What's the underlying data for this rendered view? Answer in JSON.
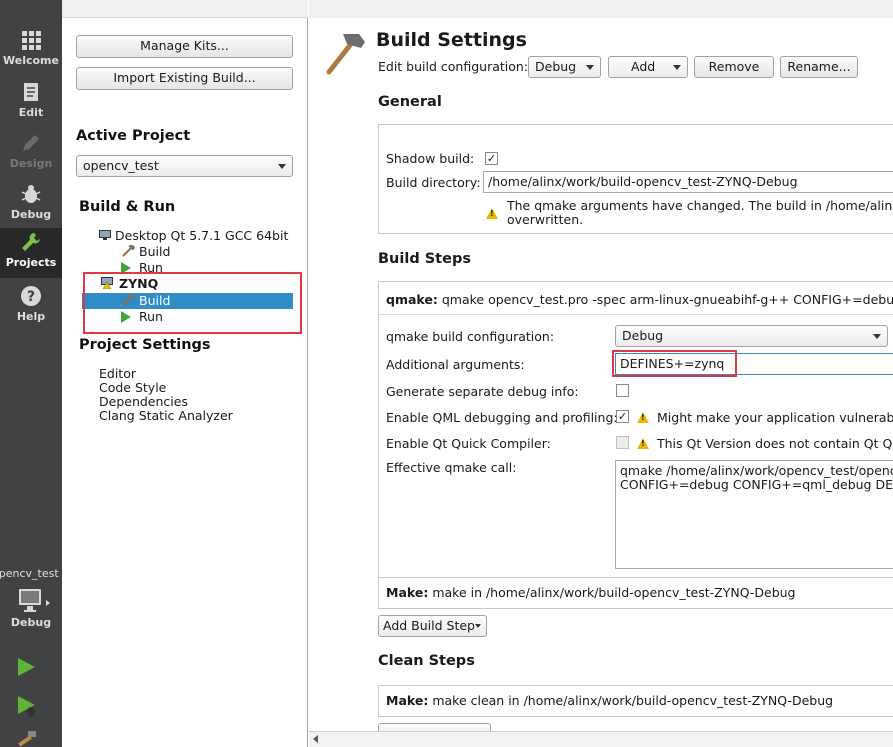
{
  "modebar": {
    "modes": [
      {
        "id": "welcome",
        "label": "Welcome",
        "icon": "grid-icon"
      },
      {
        "id": "edit",
        "label": "Edit",
        "icon": "document-icon"
      },
      {
        "id": "design",
        "label": "Design",
        "icon": "pencil-icon"
      },
      {
        "id": "debug",
        "label": "Debug",
        "icon": "bug-icon"
      },
      {
        "id": "projects",
        "label": "Projects",
        "icon": "wrench-icon"
      },
      {
        "id": "help",
        "label": "Help",
        "icon": "question-icon"
      }
    ],
    "target_project": "opencv_test",
    "target_kit_label": "Debug"
  },
  "nav": {
    "manage_kits": "Manage Kits...",
    "import_build": "Import Existing Build...",
    "active_project_title": "Active Project",
    "active_project_value": "opencv_test",
    "build_run_title": "Build & Run",
    "kits": [
      {
        "name": "Desktop Qt 5.7.1 GCC 64bit",
        "build": "Build",
        "run": "Run"
      },
      {
        "name": "ZYNQ",
        "build": "Build",
        "run": "Run"
      }
    ],
    "project_settings_title": "Project Settings",
    "project_settings": [
      "Editor",
      "Code Style",
      "Dependencies",
      "Clang Static Analyzer"
    ]
  },
  "main": {
    "title": "Build Settings",
    "edit_config_label": "Edit build configuration:",
    "config_value": "Debug",
    "add_label": "Add",
    "remove_label": "Remove",
    "rename_label": "Rename...",
    "general": {
      "title": "General",
      "shadow_build_label": "Shadow build:",
      "shadow_build_checked": "✓",
      "build_dir_label": "Build directory:",
      "build_dir_value": "/home/alinx/work/build-opencv_test-ZYNQ-Debug",
      "warning_line1": "The qmake arguments have changed. The build in /home/alinx/w",
      "warning_line2": "overwritten."
    },
    "build_steps": {
      "title": "Build Steps",
      "qmake_bold": "qmake:",
      "qmake_summary": "qmake opencv_test.pro -spec arm-linux-gnueabihf-g++ CONFIG+=debug C",
      "qmake_config_label": "qmake build configuration:",
      "qmake_config_value": "Debug",
      "additional_args_label": "Additional arguments:",
      "additional_args_value": "DEFINES+=zynq",
      "separate_debug_label": "Generate separate debug info:",
      "qml_debug_label": "Enable QML debugging and profiling:",
      "qml_debug_checked": "✓",
      "qml_warning": "Might make your application vulnerable",
      "quick_compiler_label": "Enable Qt Quick Compiler:",
      "quick_compiler_warning": "This Qt Version does not contain Qt Quic",
      "effective_label": "Effective qmake call:",
      "effective_line1": "qmake /home/alinx/work/opencv_test/opencv",
      "effective_line2": "CONFIG+=debug CONFIG+=qml_debug DEFI",
      "make_bold": "Make:",
      "make_summary": "make in /home/alinx/work/build-opencv_test-ZYNQ-Debug",
      "add_build_step": "Add Build Step"
    },
    "clean_steps": {
      "title": "Clean Steps",
      "make_bold": "Make:",
      "make_summary": "make clean in /home/alinx/work/build-opencv_test-ZYNQ-Debug"
    }
  }
}
